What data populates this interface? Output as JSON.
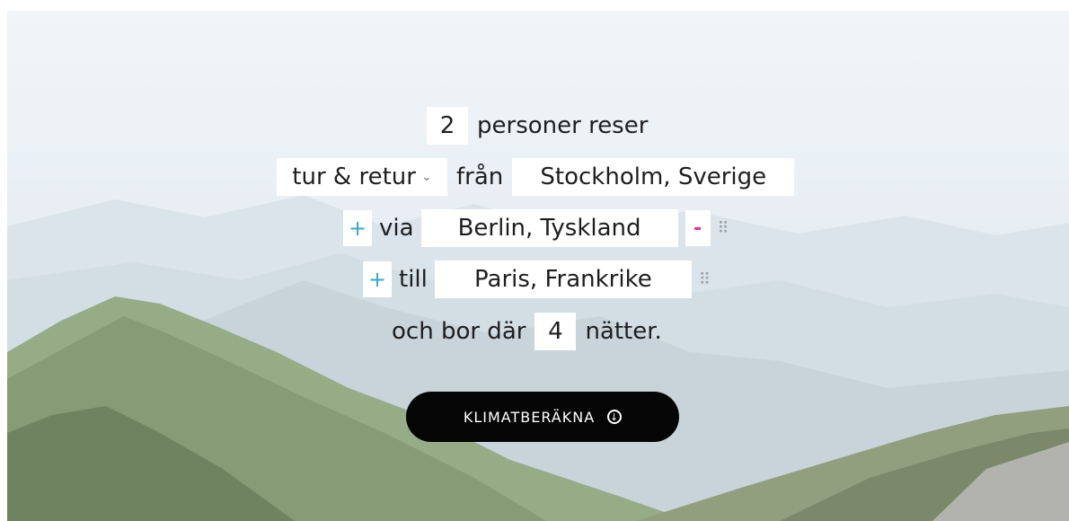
{
  "form": {
    "travelers_value": "2",
    "travelers_label": "personer reser",
    "trip_type": "tur & retur",
    "from_label": "från",
    "from_value": "Stockholm, Sverige",
    "add_stop_glyph": "+",
    "via_label": "via",
    "via_value": "Berlin, Tyskland",
    "remove_glyph": "-",
    "to_label": "till",
    "to_value": "Paris, Frankrike",
    "stay_prefix": "och bor där",
    "nights_value": "4",
    "stay_suffix": "nätter."
  },
  "cta": {
    "label": "KLIMATBERÄKNA"
  },
  "colors": {
    "accent_plus": "#3aa6c8",
    "accent_minus": "#d63a95",
    "button_bg": "#050505"
  },
  "icons": [
    "chevron-down-icon",
    "drag-handle-icon",
    "arrow-down-circle-icon"
  ]
}
